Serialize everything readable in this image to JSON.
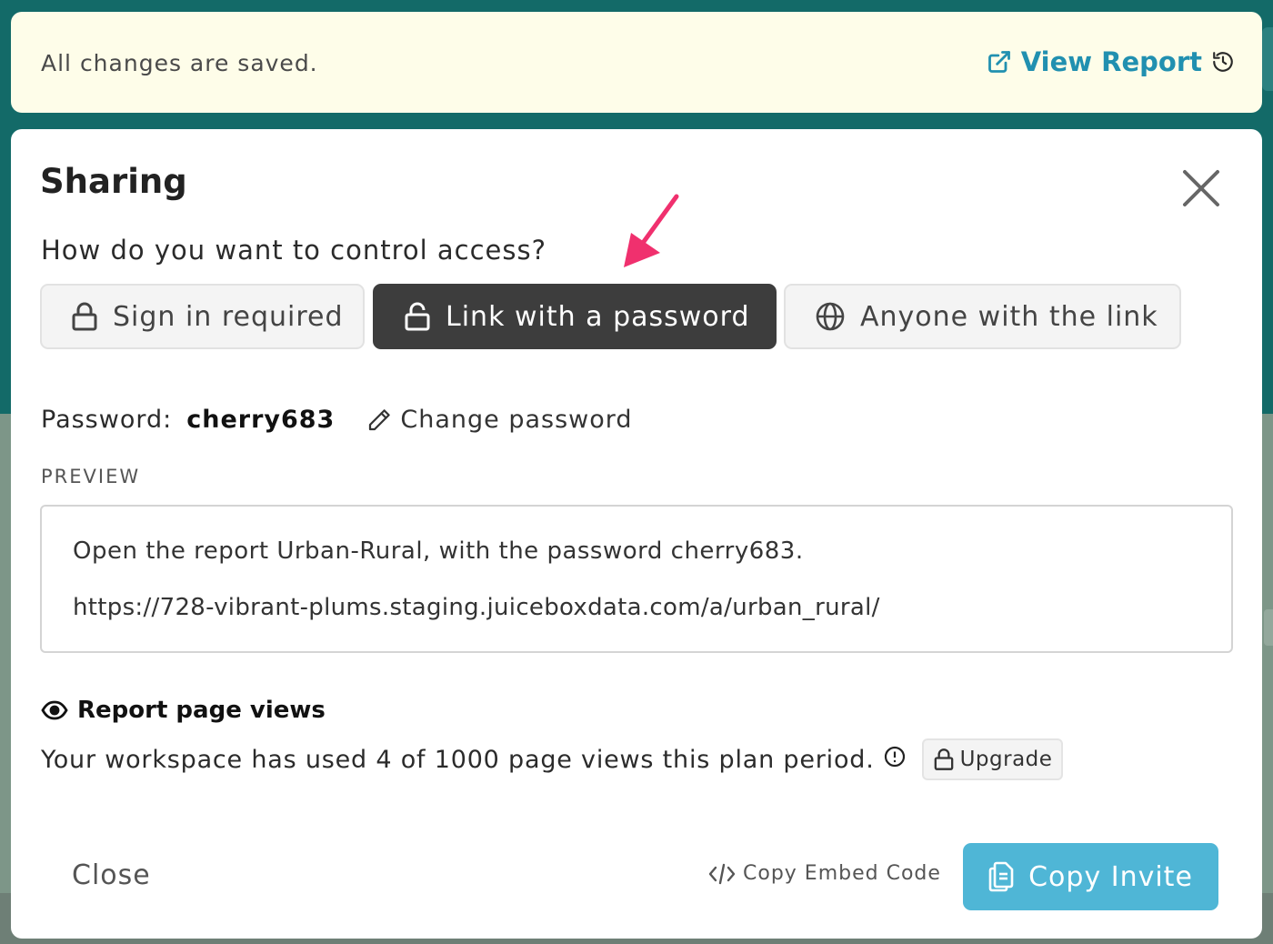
{
  "banner": {
    "status_text": "All changes are saved.",
    "view_report_label": "View Report",
    "accent_color": "#2190b0"
  },
  "modal": {
    "title": "Sharing",
    "question": "How do you want to control access?",
    "access_options": [
      {
        "label": "Sign in required",
        "icon": "lock-icon",
        "selected": false
      },
      {
        "label": "Link with a password",
        "icon": "unlock-icon",
        "selected": true
      },
      {
        "label": "Anyone with the link",
        "icon": "globe-icon",
        "selected": false
      }
    ],
    "password": {
      "label": "Password:",
      "value": "cherry683",
      "change_label": "Change password"
    },
    "preview": {
      "label": "PREVIEW",
      "line1": "Open the report Urban-Rural, with the password cherry683.",
      "line2": "https://728-vibrant-plums.staging.juiceboxdata.com/a/urban_rural/"
    },
    "page_views": {
      "heading": "Report page views",
      "usage_text": "Your workspace has used 4 of 1000 page views this plan period.",
      "upgrade_label": "Upgrade"
    },
    "footer": {
      "close_label": "Close",
      "embed_label": "Copy Embed Code",
      "invite_label": "Copy Invite",
      "invite_color": "#4fb6d6"
    }
  },
  "annotation_color": "#f0306e"
}
